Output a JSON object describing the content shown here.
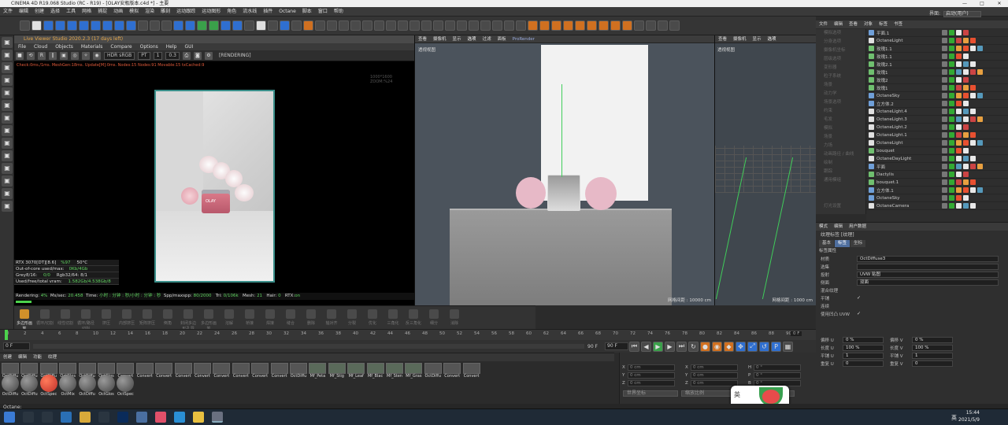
{
  "window": {
    "title": "CINEMA 4D R19.068 Studio (RC - R19) - [OLAY安瓶版本.c4d *] - 主要"
  },
  "menu": [
    "文件",
    "编辑",
    "创建",
    "选择",
    "工具",
    "网格",
    "捕捉",
    "动画",
    "模拟",
    "渲染",
    "雕刻",
    "运动跟踪",
    "运动图形",
    "角色",
    "流水线",
    "插件",
    "Octane",
    "脚本",
    "窗口",
    "帮助"
  ],
  "layout": {
    "label": "界面:",
    "value": "启动(用户)"
  },
  "live_viewer": {
    "title": "Live Viewer Studio 2020.2.3 (17 days left)",
    "menu": [
      "File",
      "Cloud",
      "Objects",
      "Materials",
      "Compare",
      "Options",
      "Help",
      "GUI"
    ],
    "color_mode": "HDR sRGB",
    "pass": "PT",
    "value_a": "1",
    "value_b": "0.3",
    "status_label": "[RENDERING]",
    "status_line": "Check:0ms./1ms. MeshGen:18ms. Update[M]:0ms. Nodes:15 Nodes:91 Movable:15 txCached:9",
    "resolution": "1000*1600 ZOOM:%24",
    "product_label": "OLAY",
    "stats": [
      {
        "l": "RTX 3070[DT][8.6]",
        "m": "%97",
        "r": "50°C"
      },
      {
        "l": "Out-of-core used/max:",
        "m": "0Kb/4Gb",
        "r": ""
      },
      {
        "l": "Grey8/16: ",
        "m": "0/0",
        "r": "Rgb32/64: 8/1"
      },
      {
        "l": "Used/free/total vram: ",
        "m": "1.582Gb/4.538Gb/8",
        "r": ""
      }
    ],
    "render_bar": {
      "rendering": "Rendering: ",
      "percent": "4%",
      "ms_label": "Ms/sec: ",
      "ms": "20.458",
      "time_label": "Time: ",
      "time": "小时 : 分钟 : 秒/小时 : 分钟 : 秒",
      "spp_label": "Spp/maxspp: ",
      "spp": "80/2000",
      "tri_label": "Tri: ",
      "tri": "0/106k",
      "mesh_label": "Mesh: ",
      "mesh": "21",
      "hair_label": "Hair: ",
      "hair": "0",
      "rtx_label": "RTX:",
      "rtx": "on"
    }
  },
  "viewport_main": {
    "menu": [
      "查看",
      "摄像机",
      "显示",
      "选项",
      "过滤",
      "面板",
      "ProRender"
    ],
    "label": "透视视图",
    "grid": "网格间距 : 10000 cm"
  },
  "viewport_side": {
    "menu": [
      "查看",
      "摄像机",
      "显示",
      "选项"
    ],
    "label": "透视视图",
    "grid": "网格间距 : 1000 cm"
  },
  "attr_list": [
    "模拟选项",
    "分身选项",
    "摄像机坐标",
    "层级选项",
    "变形器",
    "粒子系统",
    "场景",
    "动力学",
    "场景选项",
    "约束",
    "毛发",
    "模拟",
    "场景",
    "力场",
    "动画路径 / 曲线",
    "绘制",
    "跟踪",
    "通用模组",
    "",
    "",
    "灯光设置"
  ],
  "object_manager": {
    "menu": [
      "文件",
      "编辑",
      "查看",
      "对象",
      "标签",
      "书签"
    ],
    "objects": [
      {
        "name": "平面.1",
        "c": "#6f9fd8"
      },
      {
        "name": "OctaneLight",
        "c": "#e0e0e0"
      },
      {
        "name": "玫瑰1.1",
        "c": "#6fbf6f"
      },
      {
        "name": "玫瑰1.1",
        "c": "#6fbf6f"
      },
      {
        "name": "玫瑰2.1",
        "c": "#6fbf6f"
      },
      {
        "name": "玫瑰1",
        "c": "#6fbf6f"
      },
      {
        "name": "玫瑰2",
        "c": "#6fbf6f"
      },
      {
        "name": "玫瑰1",
        "c": "#6fbf6f"
      },
      {
        "name": "OctaneSky",
        "c": "#6f9fd8"
      },
      {
        "name": "立方体.2",
        "c": "#6f9fd8"
      },
      {
        "name": "OctaneLight.4",
        "c": "#e0e0e0"
      },
      {
        "name": "OctaneLight.3",
        "c": "#e0e0e0"
      },
      {
        "name": "OctaneLight.2",
        "c": "#e0e0e0"
      },
      {
        "name": "OctaneLight.1",
        "c": "#e0e0e0"
      },
      {
        "name": "OctaneLight",
        "c": "#e0e0e0"
      },
      {
        "name": "bouquet",
        "c": "#6fbf6f"
      },
      {
        "name": "OctaneDayLight",
        "c": "#e0e0e0"
      },
      {
        "name": "平面",
        "c": "#6f9fd8"
      },
      {
        "name": "Dactylis",
        "c": "#6fbf6f"
      },
      {
        "name": "bouquet.1",
        "c": "#6fbf6f"
      },
      {
        "name": "立方体.1",
        "c": "#6f9fd8"
      },
      {
        "name": "OctaneSky",
        "c": "#6f9fd8"
      },
      {
        "name": "OctaneCamera",
        "c": "#e0e0e0"
      }
    ]
  },
  "attributes": {
    "menu": [
      "模式",
      "编辑",
      "用户数据"
    ],
    "title": "纹理标签 [纹理]",
    "tabs": [
      "基本",
      "标签",
      "坐标"
    ],
    "section": "标签属性",
    "fields": [
      {
        "k": "材质",
        "v": "OctDiffuse3"
      },
      {
        "k": "选集",
        "v": ""
      },
      {
        "k": "投射",
        "v": "UVW 贴图"
      },
      {
        "k": "侧面",
        "v": "双面"
      }
    ],
    "checks": [
      {
        "k": "混合纹理",
        "v": ""
      },
      {
        "k": "平铺",
        "v": "✓"
      },
      {
        "k": "连续",
        "v": ""
      },
      {
        "k": "使用凹凸 UVW",
        "v": "✓"
      }
    ],
    "coords": [
      {
        "k": "偏移 U",
        "v": "0 %",
        "k2": "偏移 V",
        "v2": "0 %"
      },
      {
        "k": "长度 U",
        "v": "100 %",
        "k2": "长度 V",
        "v2": "100 %"
      },
      {
        "k": "平铺 U",
        "v": "1",
        "k2": "平铺 V",
        "v2": "1"
      },
      {
        "k": "重复 U",
        "v": "0",
        "k2": "重复 V",
        "v2": "0"
      }
    ]
  },
  "commands": [
    "多边形画笔",
    "循环/切割",
    "线性切割",
    "循环/路径切割",
    "挤压",
    "内部挤压",
    "矩阵挤压",
    "倒角",
    "封闭多边形孔洞",
    "多边形画笔",
    "溶解",
    "桥接",
    "焊接",
    "缝合",
    "删除",
    "轴对齐",
    "分裂",
    "优化",
    "三角化",
    "反三角化",
    "细分",
    "消除"
  ],
  "timeline": {
    "ticks": [
      "0",
      "2",
      "4",
      "6",
      "8",
      "10",
      "12",
      "14",
      "16",
      "18",
      "20",
      "22",
      "24",
      "26",
      "28",
      "30",
      "32",
      "34",
      "36",
      "38",
      "40",
      "42",
      "44",
      "46",
      "48",
      "50",
      "52",
      "54",
      "56",
      "58",
      "60",
      "62",
      "64",
      "66",
      "68",
      "70",
      "72",
      "74",
      "76",
      "78",
      "80",
      "82",
      "84",
      "86",
      "88",
      "90"
    ],
    "start": "0 F",
    "end": "90 F",
    "end2": "90 F",
    "current": "0 F"
  },
  "materials": {
    "menu": [
      "创建",
      "编辑",
      "功能",
      "纹理"
    ],
    "row1": [
      "OctDiffu",
      "OctDiffu",
      "OctDiffu",
      "OctGlos",
      "OctDiffu",
      "OctGlos",
      "Convert",
      "Convert",
      "Convert",
      "Convert",
      "Convert",
      "Convert",
      "Convert",
      "Convert",
      "Convert",
      "OctDiffu",
      "Mf_Peta",
      "Mf_Stig",
      "Mf_Leaf",
      "Mf_Blac",
      "Mf_Sten",
      "Mf_Gras",
      "OctDiffu",
      "Convert",
      "Convert"
    ],
    "row2": [
      "OctDiffu",
      "OctDiffu",
      "OctSpec",
      "OctMix",
      "OctDiffu",
      "OctGlos",
      "OctSpec"
    ]
  },
  "coordinates": {
    "rows": [
      {
        "a": "X",
        "av": "0 cm",
        "b": "X",
        "bv": "0 cm",
        "c": "H",
        "cv": "0 °"
      },
      {
        "a": "Y",
        "av": "0 cm",
        "b": "Y",
        "bv": "0 cm",
        "c": "P",
        "cv": "0 °"
      },
      {
        "a": "Z",
        "av": "0 cm",
        "b": "Z",
        "bv": "0 cm",
        "c": "B",
        "cv": "0 °"
      }
    ],
    "mode": "世界坐标",
    "size": "缩放比例",
    "apply": "应用"
  },
  "statusbar": {
    "text": "Octane:"
  },
  "taskbar": {
    "time": "15:44",
    "date": "2021/5/9",
    "lang": "英"
  },
  "ime": {
    "label": "英"
  }
}
